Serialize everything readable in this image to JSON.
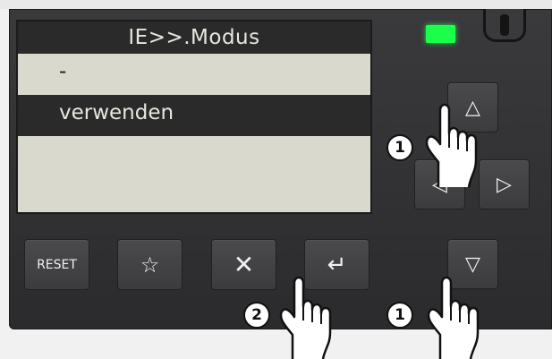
{
  "lcd": {
    "title": "IE>>.Modus",
    "options": [
      "-",
      "verwenden"
    ],
    "selected_index": 1
  },
  "buttons": {
    "reset": "RESET",
    "star": "☆",
    "cancel": "✕",
    "enter": "↵",
    "up": "△",
    "left": "◁",
    "right": "▷",
    "down": "▽"
  },
  "markers": {
    "step1_up": "1",
    "step2_enter": "2",
    "step1_down": "1"
  },
  "colors": {
    "led": "#1cff4a",
    "lcd_bg": "#d9d9cd",
    "lcd_highlight": "#2a2a2a",
    "housing": "#333335"
  }
}
